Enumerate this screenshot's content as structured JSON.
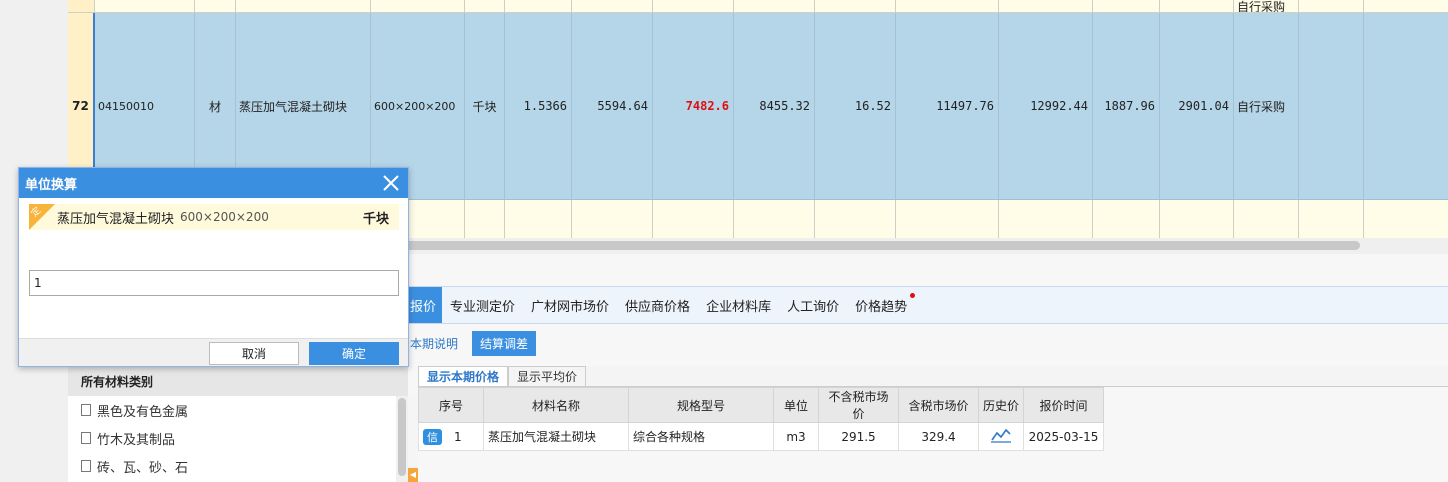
{
  "grid": {
    "top_row_tail": "自行采购",
    "selected_row": {
      "no": "72",
      "code": "04150010",
      "type": "材",
      "name": "蒸压加气混凝土砌块",
      "spec": "600×200×200",
      "unit": "千块",
      "qty": "1.5366",
      "v1": "5594.64",
      "v2": "7482.6",
      "v3": "8455.32",
      "v4": "16.52",
      "v5": "11497.76",
      "v6": "12992.44",
      "v7": "1887.96",
      "v8": "2901.04",
      "supply": "自行采购"
    }
  },
  "tabs": {
    "items": [
      {
        "label": "报价"
      },
      {
        "label": "专业测定价"
      },
      {
        "label": "广材网市场价"
      },
      {
        "label": "供应商价格"
      },
      {
        "label": "企业材料库"
      },
      {
        "label": "人工询价"
      },
      {
        "label": "价格趋势"
      }
    ]
  },
  "subbar": {
    "link": "本期说明",
    "button": "结算调差"
  },
  "toggles": {
    "current": "显示本期价格",
    "average": "显示平均价"
  },
  "price_table": {
    "headers": [
      "序号",
      "材料名称",
      "规格型号",
      "单位",
      "不含税市场价",
      "含税市场价",
      "历史价",
      "报价时间"
    ],
    "row": {
      "badge": "信",
      "no": "1",
      "name": "蒸压加气混凝土砌块",
      "spec": "综合各种规格",
      "unit": "m3",
      "price_ex": "291.5",
      "price_in": "329.4",
      "date": "2025-03-15"
    }
  },
  "tree": {
    "header": "所有材料类别",
    "items": [
      {
        "label": "黑色及有色金属"
      },
      {
        "label": "竹木及其制品"
      },
      {
        "label": "砖、瓦、砂、石"
      }
    ]
  },
  "dialog": {
    "title": "单位换算",
    "corner_tag": "定",
    "item_name": "蒸压加气混凝土砌块",
    "item_spec": "600×200×200",
    "item_unit": "千块",
    "input_value": "1",
    "cancel": "取消",
    "ok": "确定"
  },
  "colors": {
    "accent": "#3b8fe0",
    "selected_row": "#b5d5e8",
    "grid_bg": "#fffde8",
    "highlight_value": "#e01010"
  }
}
